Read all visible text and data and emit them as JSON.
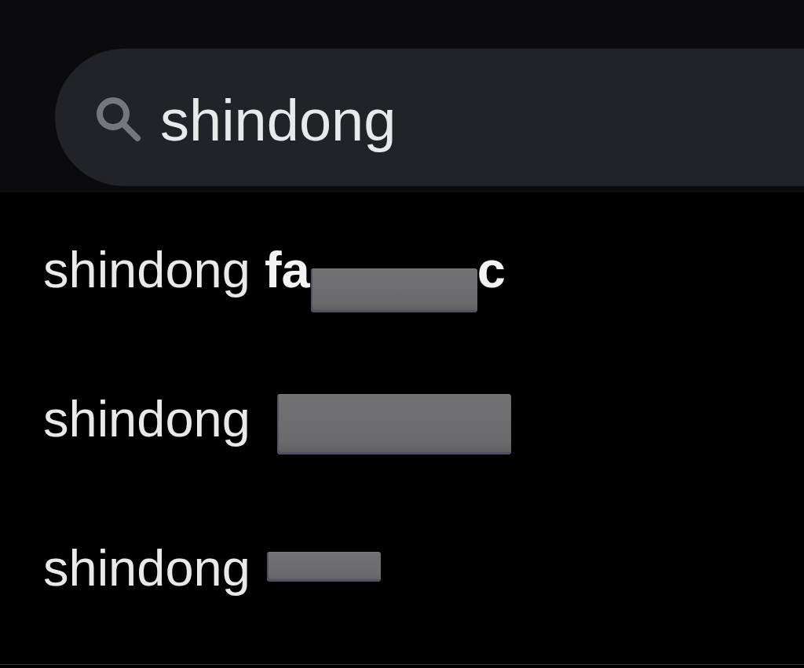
{
  "search": {
    "value": "shindong"
  },
  "suggestions": [
    {
      "parts": [
        {
          "kind": "text",
          "text": "shindong **fa**"
        },
        {
          "kind": "redaction"
        },
        {
          "kind": "text",
          "text": "**c**"
        }
      ]
    },
    {
      "parts": [
        {
          "kind": "text",
          "text": "shindong"
        },
        {
          "kind": "redaction"
        }
      ]
    },
    {
      "parts": [
        {
          "kind": "text",
          "text": "shindong"
        },
        {
          "kind": "redaction"
        }
      ]
    }
  ]
}
